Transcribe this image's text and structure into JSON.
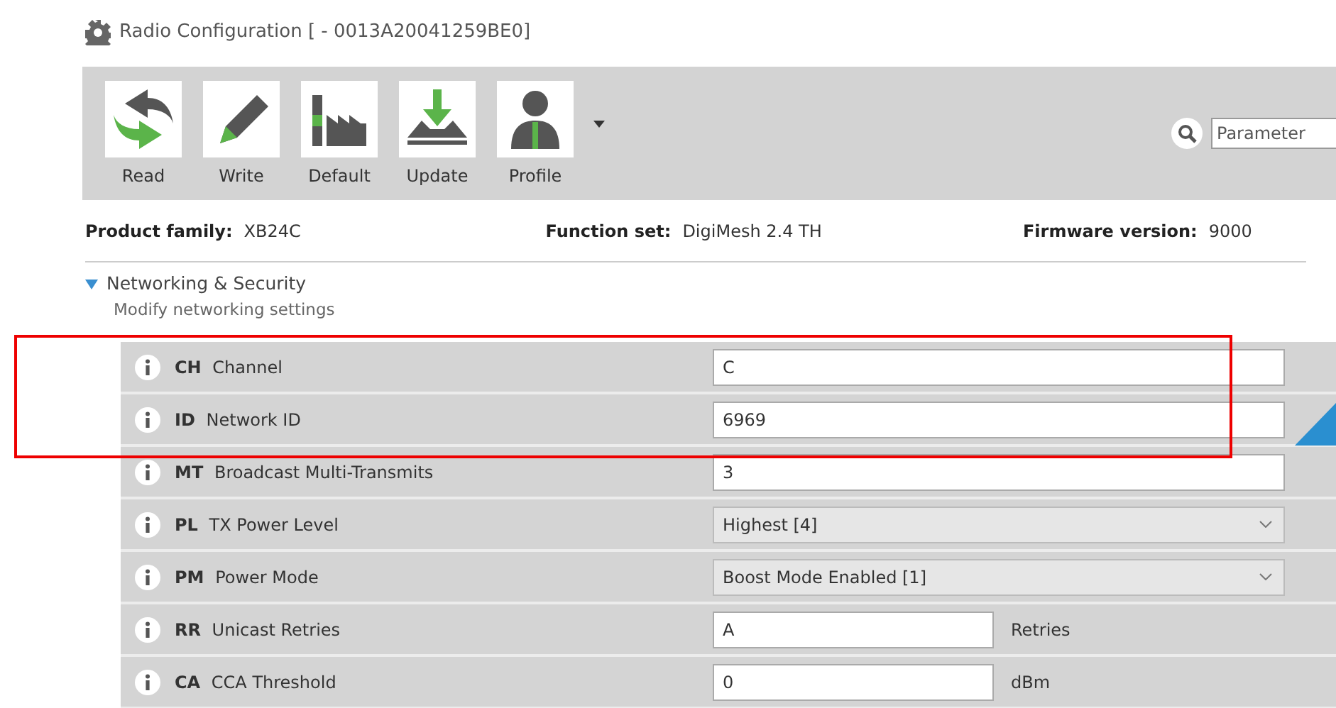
{
  "window": {
    "title": "Radio Configuration [ - 0013A20041259BE0]"
  },
  "toolbar": {
    "buttons": [
      {
        "label": "Read",
        "kind": "read"
      },
      {
        "label": "Write",
        "kind": "write"
      },
      {
        "label": "Default",
        "kind": "default"
      },
      {
        "label": "Update",
        "kind": "update"
      },
      {
        "label": "Profile",
        "kind": "profile"
      }
    ],
    "search": {
      "placeholder": "Parameter"
    }
  },
  "device_info": [
    {
      "label": "Product family:",
      "value": "XB24C"
    },
    {
      "label": "Function set:",
      "value": "DigiMesh 2.4 TH"
    },
    {
      "label": "Firmware version:",
      "value": "9000"
    }
  ],
  "section": {
    "title": "Networking & Security",
    "subtitle": "Modify networking settings",
    "expanded": true,
    "rows": [
      {
        "code": "CH",
        "name": "Channel",
        "kind": "text",
        "value": "C"
      },
      {
        "code": "ID",
        "name": "Network ID",
        "kind": "text",
        "value": "6969"
      },
      {
        "code": "MT",
        "name": "Broadcast Multi-Transmits",
        "kind": "text",
        "value": "3"
      },
      {
        "code": "PL",
        "name": "TX Power Level",
        "kind": "select",
        "value": "Highest [4]"
      },
      {
        "code": "PM",
        "name": "Power Mode",
        "kind": "select",
        "value": "Boost Mode Enabled [1]"
      },
      {
        "code": "RR",
        "name": "Unicast Retries",
        "kind": "short",
        "value": "A",
        "unit": "Retries"
      },
      {
        "code": "CA",
        "name": "CCA Threshold",
        "kind": "short",
        "value": "0",
        "unit": "dBm"
      }
    ]
  }
}
